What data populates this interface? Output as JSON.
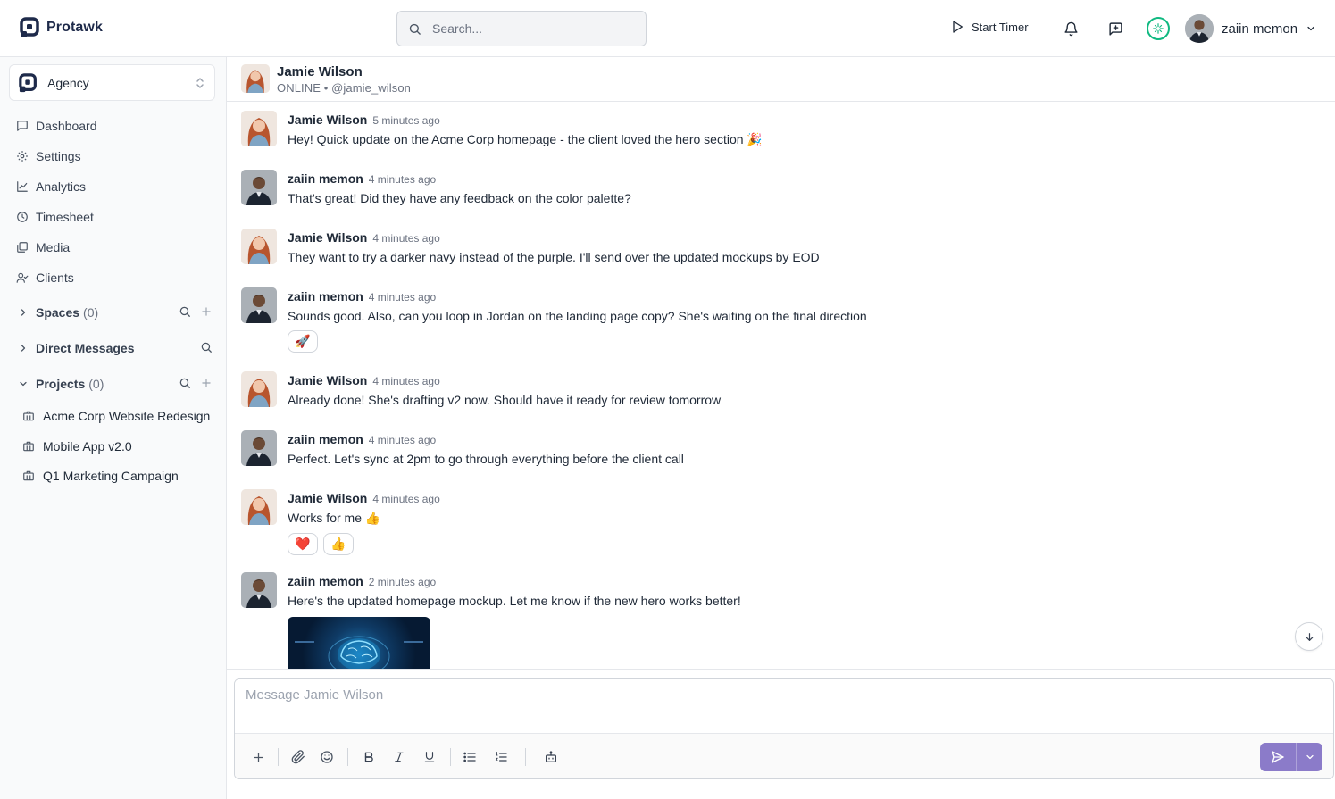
{
  "app": {
    "name": "Protawk"
  },
  "search": {
    "placeholder": "Search..."
  },
  "topbar": {
    "start_timer": "Start Timer",
    "user_name": "zaiin memon"
  },
  "workspace": {
    "name": "Agency"
  },
  "nav": [
    {
      "label": "Dashboard",
      "icon": "chat-square-icon"
    },
    {
      "label": "Settings",
      "icon": "gear-icon"
    },
    {
      "label": "Analytics",
      "icon": "chart-line-icon"
    },
    {
      "label": "Timesheet",
      "icon": "clock-icon"
    },
    {
      "label": "Media",
      "icon": "image-stack-icon"
    },
    {
      "label": "Clients",
      "icon": "user-check-icon"
    }
  ],
  "sections": {
    "spaces": {
      "title": "Spaces",
      "count": "(0)"
    },
    "direct_messages": {
      "title": "Direct Messages"
    },
    "projects": {
      "title": "Projects",
      "count": "(0)"
    }
  },
  "projects": [
    {
      "label": "Acme Corp Website Redesign"
    },
    {
      "label": "Mobile App v2.0"
    },
    {
      "label": "Q1 Marketing Campaign"
    }
  ],
  "chat": {
    "title": "Jamie Wilson",
    "subtitle": "ONLINE • @jamie_wilson",
    "composer_placeholder": "Message Jamie Wilson"
  },
  "messages": [
    {
      "author": "Jamie Wilson",
      "time": "5 minutes ago",
      "text": "Hey! Quick update on the Acme Corp homepage - the client loved the hero section 🎉"
    },
    {
      "author": "zaiin memon",
      "time": "4 minutes ago",
      "text": "That's great! Did they have any feedback on the color palette?"
    },
    {
      "author": "Jamie Wilson",
      "time": "4 minutes ago",
      "text": "They want to try a darker navy instead of the purple. I'll send over the updated mockups by EOD"
    },
    {
      "author": "zaiin memon",
      "time": "4 minutes ago",
      "text": "Sounds good. Also, can you loop in Jordan on the landing page copy? She's waiting on the final direction",
      "reactions": [
        "🚀"
      ]
    },
    {
      "author": "Jamie Wilson",
      "time": "4 minutes ago",
      "text": "Already done! She's drafting v2 now. Should have it ready for review tomorrow"
    },
    {
      "author": "zaiin memon",
      "time": "4 minutes ago",
      "text": "Perfect. Let's sync at 2pm to go through everything before the client call"
    },
    {
      "author": "Jamie Wilson",
      "time": "4 minutes ago",
      "text": "Works for me 👍",
      "reactions": [
        "❤️",
        "👍"
      ]
    },
    {
      "author": "zaiin memon",
      "time": "2 minutes ago",
      "text": "Here's the updated homepage mockup. Let me know if the new hero works better!"
    }
  ],
  "colors": {
    "accent": "#8b7bc9",
    "online": "#10b981",
    "logo": "#1e2a4a"
  }
}
